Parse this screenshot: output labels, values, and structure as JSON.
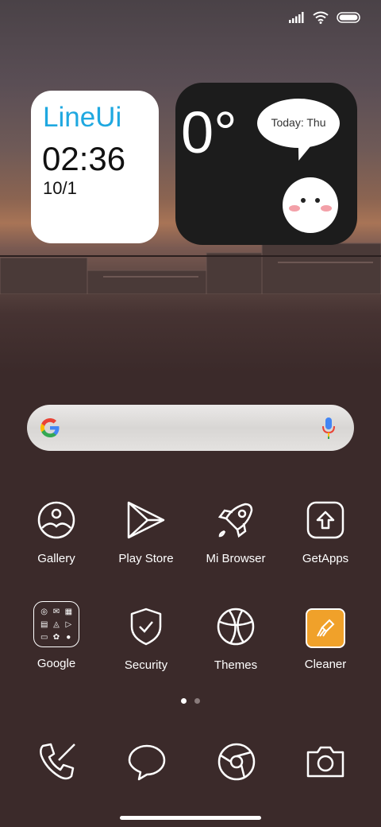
{
  "widgets": {
    "lineui": {
      "brand": "LineUi",
      "time": "02:36",
      "date": "10/1"
    },
    "weather": {
      "temp": "0°",
      "bubble": "Today: Thu"
    }
  },
  "search": {
    "icon": "google-g-icon",
    "mic_icon": "mic-icon"
  },
  "apps_row1": [
    {
      "label": "Gallery",
      "icon": "gallery-icon"
    },
    {
      "label": "Play Store",
      "icon": "play-store-icon"
    },
    {
      "label": "Mi Browser",
      "icon": "rocket-icon"
    },
    {
      "label": "GetApps",
      "icon": "upload-icon"
    }
  ],
  "apps_row2": [
    {
      "label": "Google",
      "icon": "folder-icon"
    },
    {
      "label": "Security",
      "icon": "shield-icon"
    },
    {
      "label": "Themes",
      "icon": "basketball-icon"
    },
    {
      "label": "Cleaner",
      "icon": "broom-icon"
    }
  ],
  "dock": [
    "phone-icon",
    "message-icon",
    "browser-icon",
    "camera-icon"
  ],
  "pager": {
    "pages": 2,
    "current": 1
  },
  "colors": {
    "brand": "#1fa8e0",
    "cleaner": "#f0a12a",
    "background": "#3b2a2a"
  }
}
